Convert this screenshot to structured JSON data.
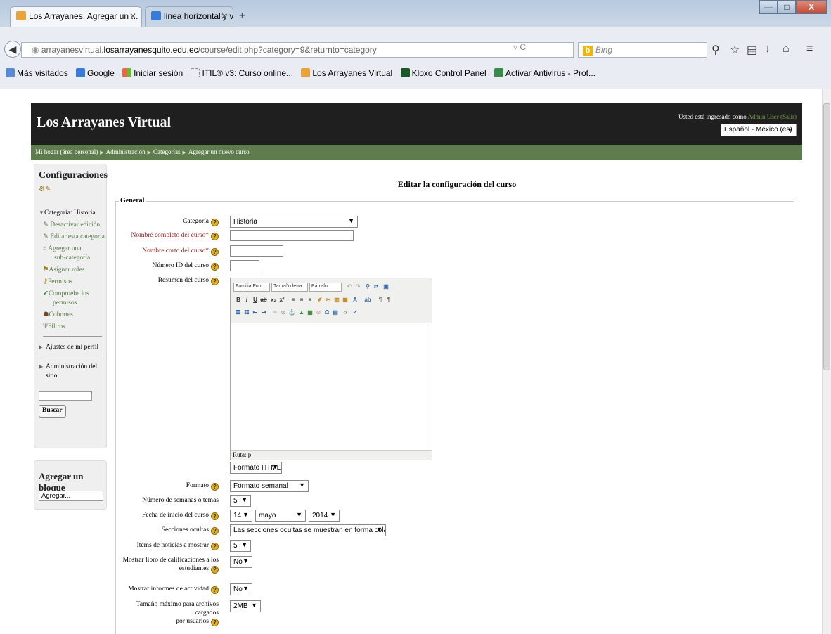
{
  "browser": {
    "tabs": [
      {
        "label": "Los Arrayanes: Agregar un ..."
      },
      {
        "label": "linea horizontal y vertical - ..."
      }
    ],
    "url_prefix": "arrayanesvirtual.",
    "url_domain": "losarrayanesquito.edu.ec",
    "url_path": "/course/edit.php?category=9&returnto=category",
    "search_placeholder": "Bing",
    "bookmarks": [
      "Más visitados",
      "Google",
      "Iniciar sesión",
      "ITIL® v3: Curso online...",
      "Los Arrayanes Virtual",
      "Kloxo Control Panel",
      "Activar Antivirus - Prot..."
    ]
  },
  "site": {
    "name": "Los Arrayanes Virtual",
    "login_prefix": "Usted está ingresado como ",
    "login_user": "Admin User",
    "login_logout": "(Salir)",
    "language": "Español - México (es)"
  },
  "breadcrumb": [
    "Mi hogar (área personal)",
    "Administración",
    "Categorías",
    "Agregar un nuevo curso"
  ],
  "sidebar": {
    "title": "Configuraciones",
    "category_label": "Categoría: Historia",
    "items": [
      "Desactivar edición",
      "Editar esta categoría",
      "Agregar una",
      "sub-categoría",
      "Asignar roles",
      "Permisos",
      "Compruebe los",
      "permisos",
      "Cohortes",
      "Filtros"
    ],
    "profile": "Ajustes de mi perfil",
    "admin": "Administración del",
    "admin2": "sitio",
    "search_button": "Buscar"
  },
  "addblock": {
    "title": "Agregar un bloque",
    "select": "Agregar..."
  },
  "form": {
    "page_title": "Editar la configuración del curso",
    "legend": "General",
    "category_label": "Categoría",
    "category_value": "Historia",
    "fullname_label": "Nombre completo del curso*",
    "shortname_label": "Nombre corto del curso*",
    "idnumber_label": "Número ID del curso",
    "summary_label": "Resumen del curso",
    "editor_font": "Familia Font",
    "editor_size": "Tamaño letra",
    "editor_para": "Párrafo",
    "editor_path": "Ruta: p",
    "format_html": "Formato HTML",
    "format_label": "Formato",
    "format_value": "Formato semanal",
    "weeks_label": "Número de semanas o temas",
    "weeks_value": "5",
    "startdate_label": "Fecha de inicio del curso",
    "start_day": "14",
    "start_month": "mayo",
    "start_year": "2014",
    "hidden_label": "Secciones ocultas",
    "hidden_value": "Las secciones ocultas se muestran en forma colapsada",
    "news_label": "Items de noticias a mostrar",
    "news_value": "5",
    "grades_label_1": "Mostrar libro de calificaciones a los",
    "grades_label_2": "estudiantes",
    "grades_value": "No",
    "reports_label": "Mostrar informes de actividad",
    "reports_value": "No",
    "maxsize_label_1": "Tamaño máximo para archivos cargados",
    "maxsize_label_2": "por usuarios",
    "maxsize_value": "2MB"
  }
}
